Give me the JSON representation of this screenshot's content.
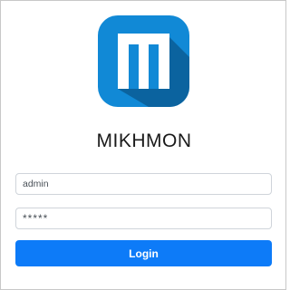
{
  "app": {
    "title": "MIKHMON",
    "logo_icon": "mikhmon-logo-icon"
  },
  "form": {
    "username_value": "admin",
    "password_value": "*****",
    "login_label": "Login"
  },
  "colors": {
    "logo_background": "#1189d6",
    "logo_shadow": "#0b5d95",
    "button_background": "#0d7bf8",
    "button_text": "#ffffff"
  }
}
